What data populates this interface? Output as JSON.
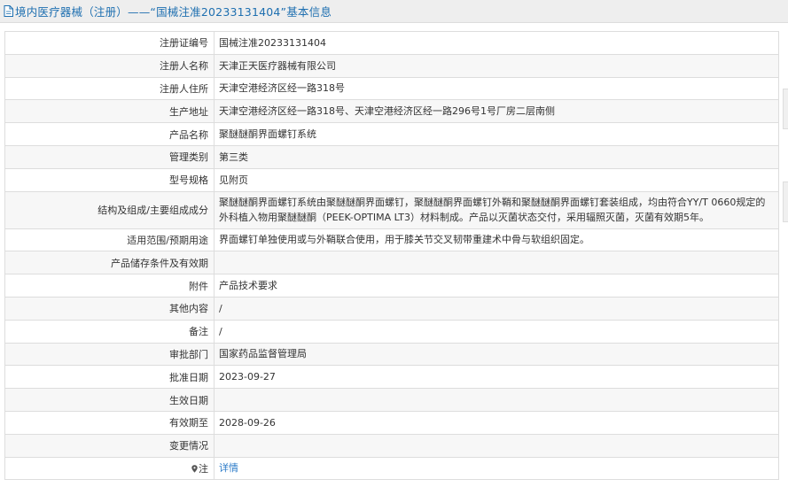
{
  "header": {
    "title": "境内医疗器械（注册）——“国械注准20233131404”基本信息"
  },
  "icons": {
    "document": "document-icon",
    "note_pin": "location-pin-icon"
  },
  "colors": {
    "title": "#1e6fb0",
    "link": "#2b7bc8",
    "border": "#dddddd",
    "row_alt": "#f7f7f7"
  },
  "rows": [
    {
      "label": "注册证编号",
      "value": "国械注准20233131404"
    },
    {
      "label": "注册人名称",
      "value": "天津正天医疗器械有限公司"
    },
    {
      "label": "注册人住所",
      "value": "天津空港经济区经一路318号"
    },
    {
      "label": "生产地址",
      "value": "天津空港经济区经一路318号、天津空港经济区经一路296号1号厂房二层南侧"
    },
    {
      "label": "产品名称",
      "value": "聚醚醚酮界面螺钉系统"
    },
    {
      "label": "管理类别",
      "value": "第三类"
    },
    {
      "label": "型号规格",
      "value": "见附页"
    },
    {
      "label": "结构及组成/主要组成成分",
      "value": "聚醚醚酮界面螺钉系统由聚醚醚酮界面螺钉，聚醚醚酮界面螺钉外鞘和聚醚醚酮界面螺钉套装组成，均由符合YY/T 0660规定的外科植入物用聚醚醚酮（PEEK-OPTIMA LT3）材料制成。产品以灭菌状态交付，采用辐照灭菌，灭菌有效期5年。"
    },
    {
      "label": "适用范围/预期用途",
      "value": "界面螺钉单独使用或与外鞘联合使用，用于膝关节交叉韧带重建术中骨与软组织固定。"
    },
    {
      "label": "产品储存条件及有效期",
      "value": ""
    },
    {
      "label": "附件",
      "value": "产品技术要求"
    },
    {
      "label": "其他内容",
      "value": "/"
    },
    {
      "label": "备注",
      "value": "/"
    },
    {
      "label": "审批部门",
      "value": "国家药品监督管理局"
    },
    {
      "label": "批准日期",
      "value": "2023-09-27"
    },
    {
      "label": "生效日期",
      "value": ""
    },
    {
      "label": "有效期至",
      "value": "2028-09-26"
    },
    {
      "label": "变更情况",
      "value": ""
    },
    {
      "label": "注",
      "value": "详情"
    }
  ]
}
